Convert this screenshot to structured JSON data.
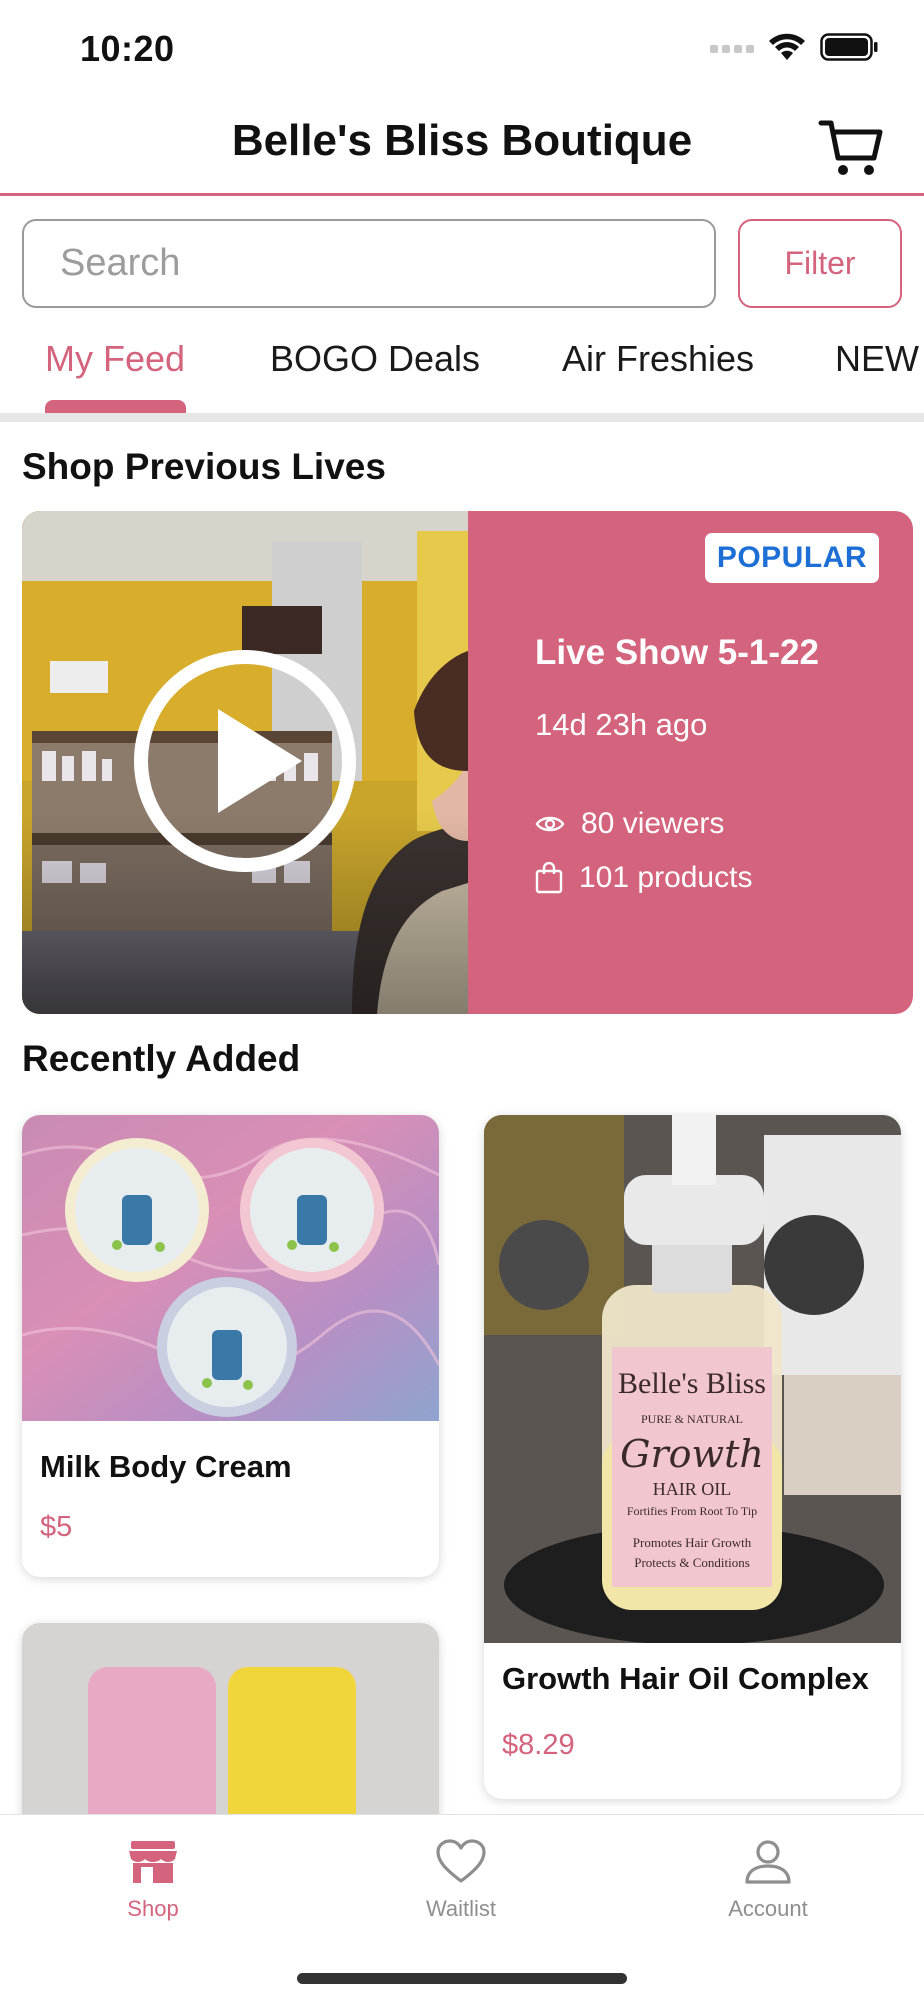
{
  "status_bar": {
    "time": "10:20"
  },
  "header": {
    "title": "Belle's Bliss Boutique"
  },
  "search": {
    "placeholder": "Search",
    "value": ""
  },
  "filter": {
    "label": "Filter"
  },
  "tabs": [
    {
      "label": "My Feed",
      "active": true
    },
    {
      "label": "BOGO Deals",
      "active": false
    },
    {
      "label": "Air Freshies",
      "active": false
    },
    {
      "label": "NEW",
      "active": false
    }
  ],
  "previous_lives": {
    "section_title": "Shop Previous Lives",
    "card": {
      "badge": "POPULAR",
      "title": "Live Show 5-1-22",
      "ago": "14d 23h ago",
      "viewers": "80 viewers",
      "products": "101 products"
    }
  },
  "recently_added": {
    "section_title": "Recently Added",
    "products": [
      {
        "name": "Milk Body Cream",
        "price": "$5"
      },
      {
        "name": "Growth Hair Oil Complex",
        "price": "$8.29"
      }
    ]
  },
  "product_image_text": {
    "brand": "Belle's Bliss",
    "tagline": "PURE & NATURAL",
    "script": "Growth",
    "label": "HAIR OIL",
    "fortifies": "Fortifies From Root To Tip",
    "promotes": "Promotes Hair Growth",
    "protects": "Protects & Conditions"
  },
  "bottom_nav": [
    {
      "label": "Shop",
      "icon": "store-icon",
      "active": true
    },
    {
      "label": "Waitlist",
      "icon": "heart-icon",
      "active": false
    },
    {
      "label": "Account",
      "icon": "person-icon",
      "active": false
    }
  ],
  "colors": {
    "accent": "#d4647e",
    "badge_text": "#1d6fd6"
  }
}
